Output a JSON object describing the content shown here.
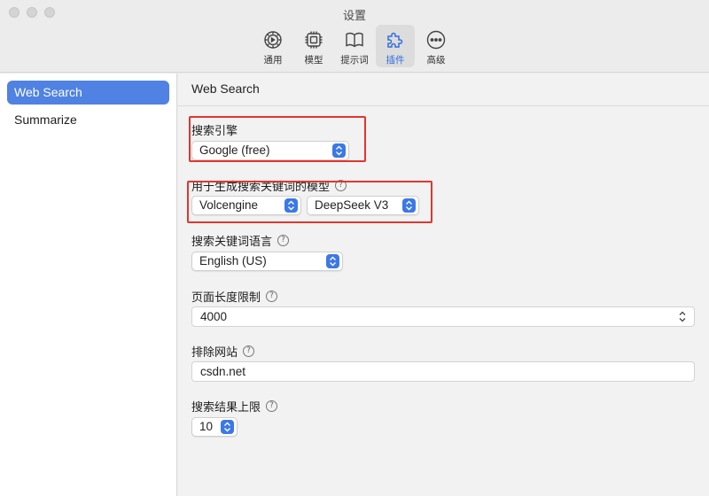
{
  "window": {
    "title": "设置"
  },
  "toolbar": {
    "tabs": [
      {
        "label": "通用",
        "icon": "gear-icon"
      },
      {
        "label": "模型",
        "icon": "chip-icon"
      },
      {
        "label": "提示词",
        "icon": "book-icon"
      },
      {
        "label": "插件",
        "icon": "puzzle-icon",
        "active": true
      },
      {
        "label": "高级",
        "icon": "more-icon"
      }
    ]
  },
  "sidebar": {
    "items": [
      {
        "label": "Web Search",
        "selected": true
      },
      {
        "label": "Summarize"
      }
    ]
  },
  "main": {
    "title": "Web Search",
    "search_engine": {
      "label": "搜索引擎",
      "value": "Google (free)"
    },
    "keyword_model": {
      "label": "用于生成搜索关键词的模型",
      "provider": "Volcengine",
      "model": "DeepSeek V3"
    },
    "keyword_language": {
      "label": "搜索关键词语言",
      "value": "English (US)"
    },
    "page_length": {
      "label": "页面长度限制",
      "value": "4000"
    },
    "exclude_sites": {
      "label": "排除网站",
      "value": "csdn.net"
    },
    "result_limit": {
      "label": "搜索结果上限",
      "value": "10"
    },
    "help_glyph": "?"
  },
  "colors": {
    "accent": "#3c78e6",
    "selected_bg": "#4f82e2",
    "highlight_box": "#e2352f"
  }
}
